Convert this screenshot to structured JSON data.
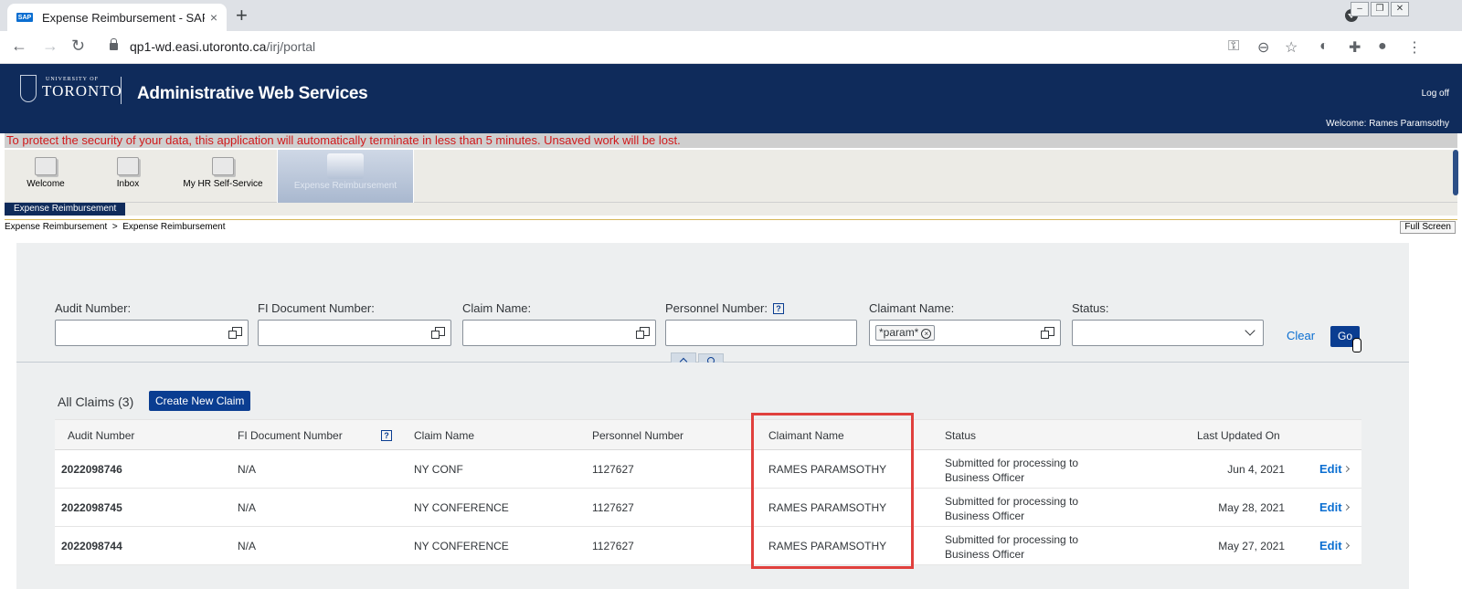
{
  "browser": {
    "tab_title": "Expense Reimbursement - SAP N",
    "tab_close": "×",
    "new_tab": "+",
    "url_host": "qp1-wd.easi.utoronto.ca",
    "url_path": "/irj/portal",
    "favicon_text": "SAP"
  },
  "portal": {
    "logo_small": "UNIVERSITY OF",
    "logo_big": "TORONTO",
    "title": "Administrative Web Services",
    "logoff": "Log off",
    "welcome": "Welcome: Rames Paramsothy",
    "warning": "To protect the security of your data, this application will automatically terminate in less than 5 minutes. Unsaved work will be lost."
  },
  "nav": {
    "items": [
      {
        "label": "Welcome"
      },
      {
        "label": "Inbox"
      },
      {
        "label": "My HR Self-Service"
      },
      {
        "label": "Expense Reimbursement"
      }
    ],
    "sub_item": "Expense Reimbursement",
    "breadcrumb": "Expense Reimbursement  >  Expense Reimbursement",
    "full_screen": "Full Screen"
  },
  "filters": {
    "audit_number_label": "Audit Number:",
    "fi_document_label": "FI Document Number:",
    "claim_name_label": "Claim Name:",
    "personnel_number_label": "Personnel Number:",
    "claimant_name_label": "Claimant Name:",
    "claimant_token": "*param*",
    "status_label": "Status:",
    "help_mark": "?",
    "clear": "Clear",
    "go": "Go"
  },
  "table": {
    "title": "All Claims (3)",
    "create_button": "Create New Claim",
    "headers": {
      "audit": "Audit Number",
      "fi": "FI Document Number",
      "claim": "Claim Name",
      "personnel": "Personnel Number",
      "claimant": "Claimant Name",
      "status": "Status",
      "updated": "Last Updated On"
    },
    "rows": [
      {
        "audit": "2022098746",
        "fi": "N/A",
        "claim": "NY CONF",
        "personnel": "1127627",
        "claimant": "RAMES PARAMSOTHY",
        "status1": "Submitted for processing to",
        "status2": "Business Officer",
        "updated": "Jun 4, 2021",
        "edit": "Edit"
      },
      {
        "audit": "2022098745",
        "fi": "N/A",
        "claim": "NY CONFERENCE",
        "personnel": "1127627",
        "claimant": "RAMES PARAMSOTHY",
        "status1": "Submitted for processing to",
        "status2": "Business Officer",
        "updated": "May 28, 2021",
        "edit": "Edit"
      },
      {
        "audit": "2022098744",
        "fi": "N/A",
        "claim": "NY CONFERENCE",
        "personnel": "1127627",
        "claimant": "RAMES PARAMSOTHY",
        "status1": "Submitted for processing to",
        "status2": "Business Officer",
        "updated": "May 27, 2021",
        "edit": "Edit"
      }
    ]
  },
  "colors": {
    "portal_header": "#0f2b5b",
    "warning_text": "#d0181a",
    "primary_button": "#0a3d91",
    "link": "#0a6ed1",
    "highlight": "#e0403d"
  }
}
